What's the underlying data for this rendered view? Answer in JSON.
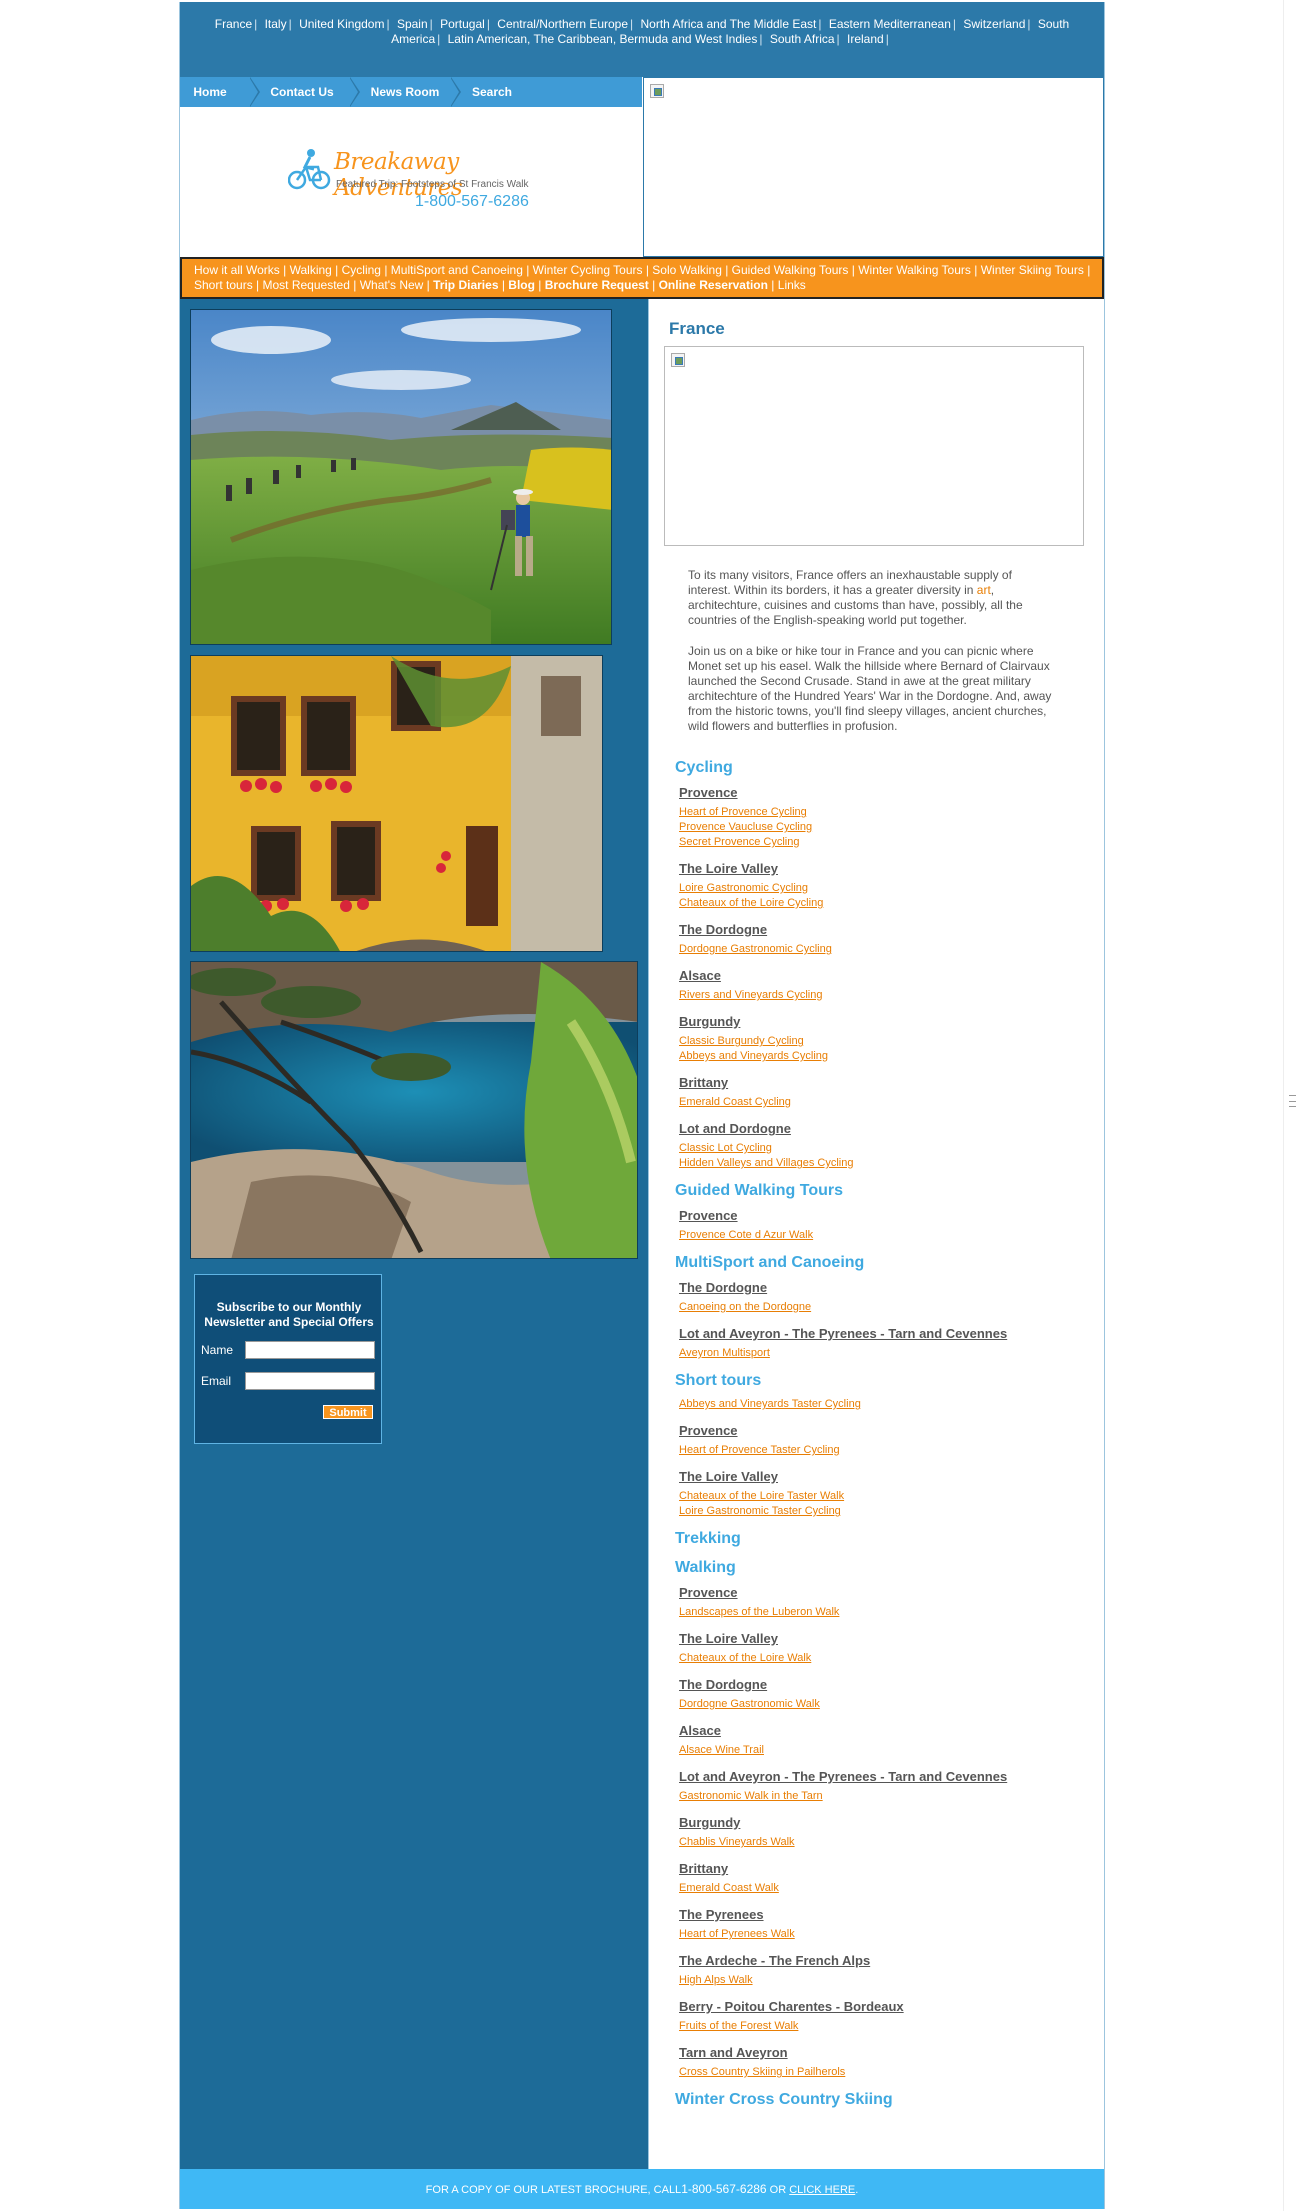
{
  "countries": [
    "France",
    "Italy",
    "United Kingdom",
    "Spain",
    "Portugal",
    "Central/Northern Europe",
    "North Africa and The Middle East",
    "Eastern Mediterranean",
    "Switzerland",
    "South America",
    "Latin American, The Caribbean, Bermuda and West Indies",
    "South Africa",
    "Ireland"
  ],
  "topnav": [
    "Home",
    "Contact Us",
    "News Room",
    "Search"
  ],
  "logo": {
    "name": "Breakaway Adventures",
    "tagline": "Featured Trip: Footsteps of St Francis Walk",
    "phone": "1-800-567-6286"
  },
  "orange_nav": {
    "plain": [
      "How it all Works",
      "Walking",
      "Cycling",
      "MultiSport and Canoeing",
      "Winter Cycling Tours",
      "Solo Walking",
      "Guided Walking Tours",
      "Winter Walking Tours",
      "Winter Skiing Tours",
      "Short tours",
      "Most Requested",
      "What's New"
    ],
    "bold": [
      "Trip Diaries",
      "Blog",
      "Brochure Request",
      "Online Reservation"
    ],
    "last": "Links"
  },
  "newsletter": {
    "title_line1": "Subscribe to our Monthly",
    "title_line2": "Newsletter and Special Offers",
    "name_label": "Name",
    "email_label": "Email",
    "name_value": "",
    "email_value": "",
    "submit": "Submit"
  },
  "page": {
    "title": "France",
    "intro1_a": "To its many visitors, France offers an inexhaustable supply of",
    "intro1_b": "interest. Within its borders, it has a greater diversity in ",
    "intro1_link": "art",
    "intro1_c": ",",
    "intro1_d": "architechture, cuisines and customs than have, possibly, all the",
    "intro1_e": "countries of the English-speaking world put together.",
    "intro2": [
      "Join us on a bike or hike tour in France and you can picnic where",
      "Monet set up his easel. Walk the hillside where Bernard of Clairvaux",
      "launched the Second Crusade. Stand in awe at the great military",
      "architechture of the Hundred Years' War in the Dordogne. And, away",
      "from the historic towns, you'll find sleepy villages, ancient churches,",
      "wild flowers and butterflies in profusion."
    ]
  },
  "sections": [
    {
      "name": "Cycling",
      "groups": [
        {
          "region": "Provence",
          "links": [
            "Heart of Provence Cycling",
            "Provence Vaucluse Cycling",
            "Secret Provence Cycling"
          ]
        },
        {
          "region": "The Loire Valley",
          "links": [
            "Loire Gastronomic Cycling",
            "Chateaux of the Loire Cycling"
          ]
        },
        {
          "region": "The Dordogne",
          "links": [
            "Dordogne Gastronomic Cycling"
          ]
        },
        {
          "region": "Alsace",
          "links": [
            "Rivers and Vineyards Cycling"
          ]
        },
        {
          "region": "Burgundy",
          "links": [
            "Classic Burgundy Cycling",
            "Abbeys and Vineyards Cycling"
          ]
        },
        {
          "region": "Brittany",
          "links": [
            "Emerald Coast Cycling"
          ]
        },
        {
          "region": "Lot and Dordogne",
          "links": [
            "Classic Lot Cycling",
            "Hidden Valleys and Villages Cycling"
          ]
        }
      ]
    },
    {
      "name": "Guided Walking Tours",
      "groups": [
        {
          "region": "Provence",
          "links": [
            "Provence Cote d Azur Walk"
          ]
        }
      ]
    },
    {
      "name": "MultiSport and Canoeing",
      "groups": [
        {
          "region": "The Dordogne",
          "links": [
            "Canoeing on the Dordogne"
          ]
        },
        {
          "region": "Lot and Aveyron - The Pyrenees - Tarn and Cevennes",
          "links": [
            "Aveyron Multisport"
          ]
        }
      ]
    },
    {
      "name": "Short tours",
      "groups": [
        {
          "region": "",
          "links": [
            "Abbeys and Vineyards Taster Cycling"
          ]
        },
        {
          "region": "Provence",
          "links": [
            "Heart of Provence Taster Cycling"
          ]
        },
        {
          "region": "The Loire Valley",
          "links": [
            "Chateaux of the Loire Taster Walk",
            "Loire Gastronomic Taster Cycling"
          ]
        }
      ]
    },
    {
      "name": "Trekking",
      "groups": []
    },
    {
      "name": "Walking",
      "groups": [
        {
          "region": "Provence",
          "links": [
            "Landscapes of the Luberon Walk"
          ]
        },
        {
          "region": "The Loire Valley",
          "links": [
            "Chateaux of the Loire Walk"
          ]
        },
        {
          "region": "The Dordogne",
          "links": [
            "Dordogne Gastronomic Walk"
          ]
        },
        {
          "region": "Alsace",
          "links": [
            "Alsace Wine Trail"
          ]
        },
        {
          "region": "Lot and Aveyron - The Pyrenees - Tarn and Cevennes",
          "links": [
            "Gastronomic Walk in the Tarn"
          ]
        },
        {
          "region": "Burgundy",
          "links": [
            "Chablis Vineyards Walk"
          ]
        },
        {
          "region": "Brittany",
          "links": [
            "Emerald Coast Walk"
          ]
        },
        {
          "region": "The Pyrenees",
          "links": [
            "Heart of Pyrenees Walk"
          ]
        },
        {
          "region": "The Ardeche - The French Alps",
          "links": [
            "High Alps Walk"
          ]
        },
        {
          "region": "Berry - Poitou Charentes - Bordeaux",
          "links": [
            "Fruits of the Forest Walk"
          ]
        },
        {
          "region": "Tarn and Aveyron",
          "links": [
            "Cross Country Skiing in Pailherols"
          ]
        }
      ]
    },
    {
      "name": "Winter Cross Country Skiing",
      "groups": []
    }
  ],
  "footer": {
    "text": "FOR A COPY OF OUR LATEST BROCHURE, CALL",
    "phone": "1-800-567-6286",
    "or": " OR ",
    "link": "CLICK HERE",
    "end": "."
  },
  "colors": {
    "primary_blue": "#2c79a9",
    "sidebar_blue": "#1d6b98",
    "accent_orange": "#f7941d",
    "link_orange": "#e87e04",
    "light_blue": "#3fa9e0"
  }
}
